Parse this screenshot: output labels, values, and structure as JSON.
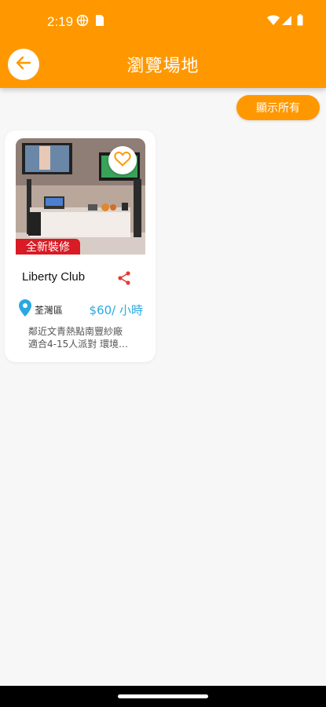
{
  "status_bar": {
    "time": "2:19",
    "icons": [
      "vpn-globe-icon",
      "sim-card-icon",
      "wifi-icon",
      "cell-signal-icon",
      "battery-icon"
    ]
  },
  "app_bar": {
    "title": "瀏覽場地",
    "back_icon": "arrow-left-icon",
    "color": "#ff9800"
  },
  "show_all_label": "顯示所有",
  "venues": [
    {
      "badge": "全新裝修",
      "name": "Liberty Club",
      "district": "荃灣區",
      "price": "$60/ 小時",
      "description_lines": [
        "鄰近文青熱點南豐紗廠",
        "適合4-15人派對 環境…"
      ],
      "favorite_icon": "heart-outline-icon",
      "share_icon": "share-icon",
      "location_icon": "location-pin-icon"
    }
  ],
  "colors": {
    "accent": "#ff9800",
    "badge": "#d81b24",
    "price": "#29a9e0",
    "location_pin": "#29a9e0",
    "share": "#e53935"
  }
}
